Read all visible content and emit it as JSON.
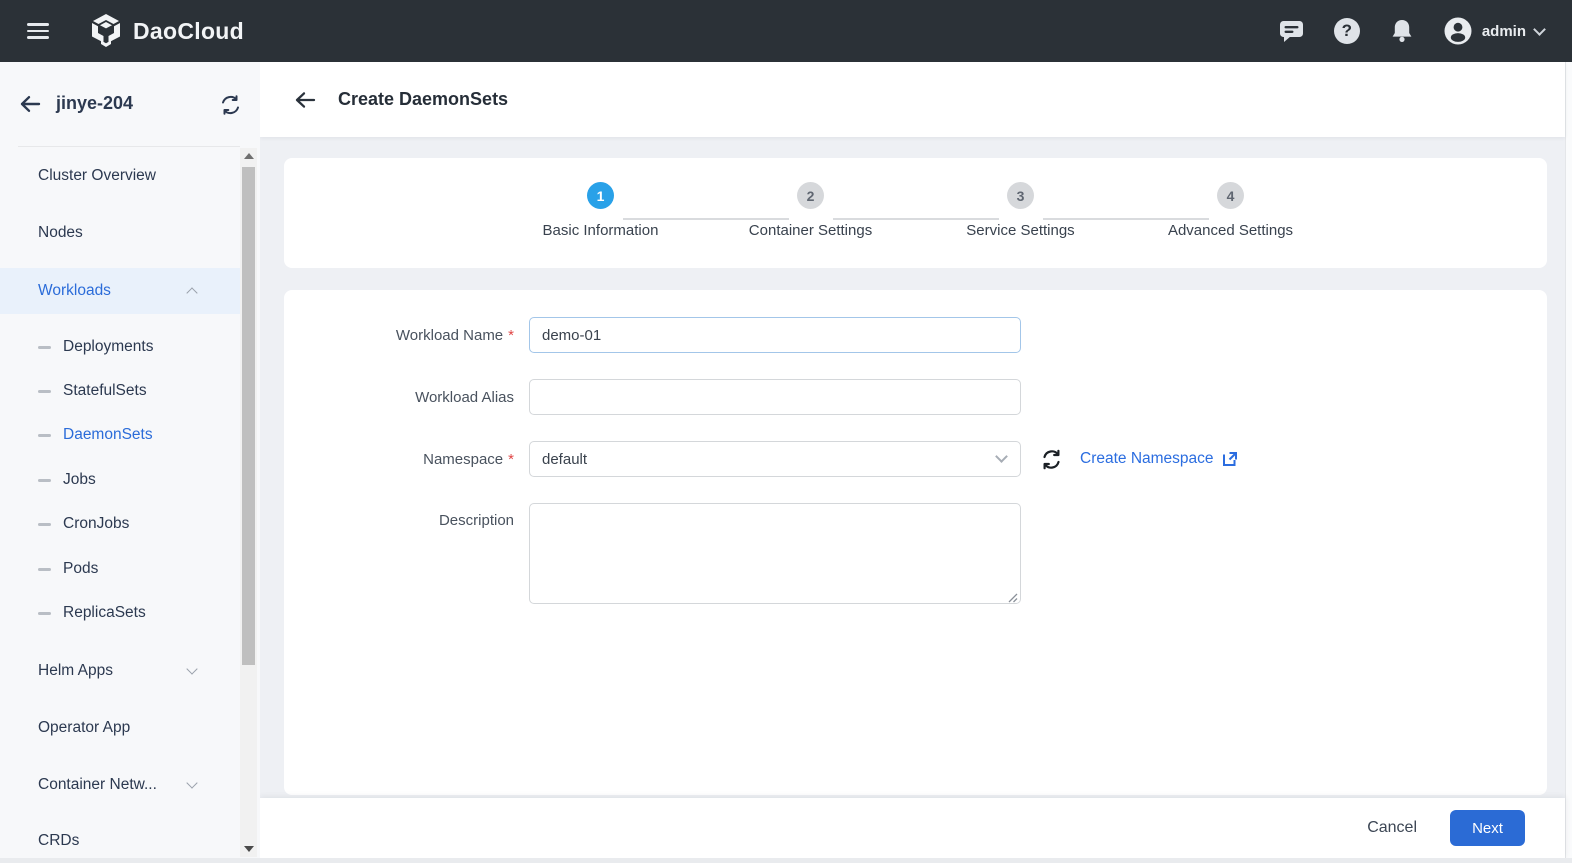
{
  "header": {
    "brand": "DaoCloud",
    "user": "admin",
    "help_glyph": "?"
  },
  "sidebar": {
    "cluster": "jinye-204",
    "items": [
      {
        "label": "Cluster Overview"
      },
      {
        "label": "Nodes"
      },
      {
        "label": "Workloads"
      },
      {
        "label": "Deployments"
      },
      {
        "label": "StatefulSets"
      },
      {
        "label": "DaemonSets"
      },
      {
        "label": "Jobs"
      },
      {
        "label": "CronJobs"
      },
      {
        "label": "Pods"
      },
      {
        "label": "ReplicaSets"
      },
      {
        "label": "Helm Apps"
      },
      {
        "label": "Operator App"
      },
      {
        "label": "Container Netw..."
      },
      {
        "label": "CRDs"
      }
    ]
  },
  "page": {
    "title": "Create DaemonSets"
  },
  "stepper": {
    "steps": [
      {
        "num": "1",
        "label": "Basic Information"
      },
      {
        "num": "2",
        "label": "Container Settings"
      },
      {
        "num": "3",
        "label": "Service Settings"
      },
      {
        "num": "4",
        "label": "Advanced Settings"
      }
    ],
    "active_step": 1
  },
  "form": {
    "required_mark": "*",
    "workload_name": {
      "label": "Workload Name",
      "value": "demo-01"
    },
    "workload_alias": {
      "label": "Workload Alias",
      "value": ""
    },
    "namespace": {
      "label": "Namespace",
      "value": "default",
      "link_label": "Create Namespace"
    },
    "description": {
      "label": "Description",
      "value": ""
    }
  },
  "footer": {
    "cancel_label": "Cancel",
    "next_label": "Next"
  },
  "colors": {
    "header_bg": "#2b3137",
    "accent_blue": "#2b6bd5",
    "link_blue": "#2b6de0",
    "step_active": "#29a1e8",
    "sidebar_active_bg": "#e9f1fb",
    "content_bg": "#eef0f4",
    "required_red": "#e04545"
  }
}
